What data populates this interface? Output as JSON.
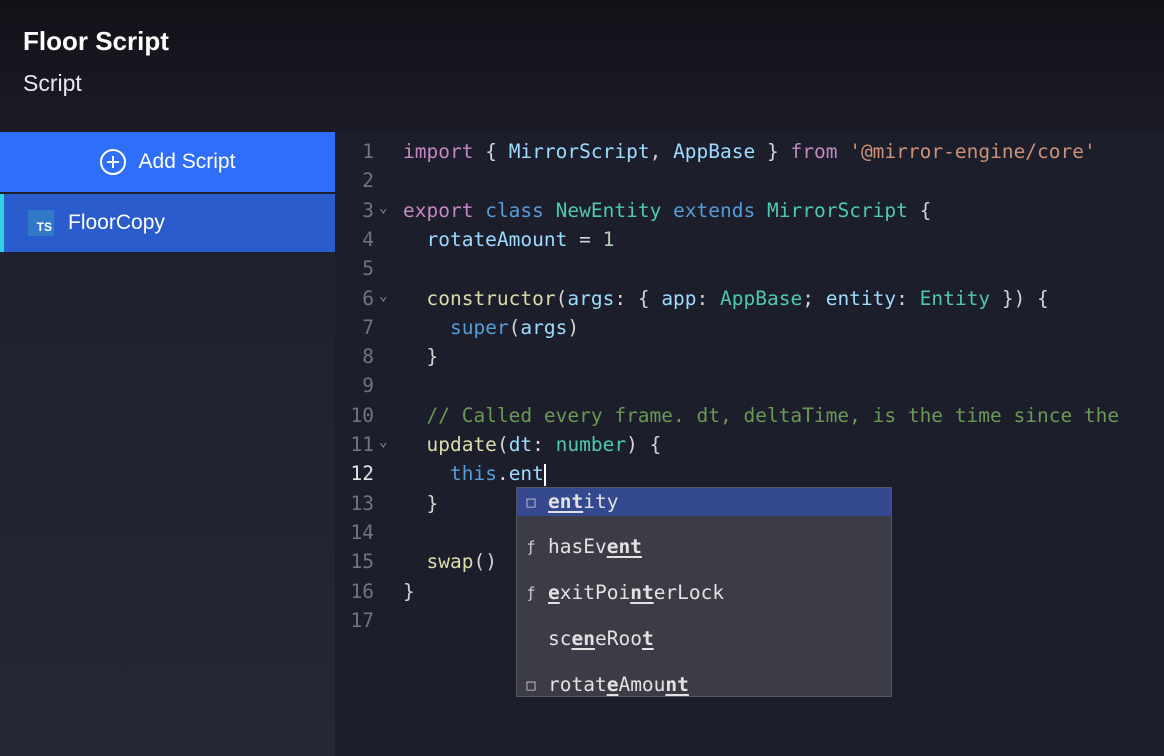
{
  "header": {
    "title": "Floor Script",
    "subtitle": "Script"
  },
  "sidebar": {
    "add_label": "Add Script",
    "items": [
      {
        "badge": "TS",
        "label": "FloorCopy"
      }
    ]
  },
  "editor": {
    "lines": [
      {
        "n": "1",
        "tokens": [
          [
            "kw",
            "import"
          ],
          [
            "p",
            " { "
          ],
          [
            "vr",
            "MirrorScript"
          ],
          [
            "p",
            ", "
          ],
          [
            "vr",
            "AppBase"
          ],
          [
            "p",
            " } "
          ],
          [
            "kw",
            "from"
          ],
          [
            "p",
            " "
          ],
          [
            "st",
            "'@mirror-engine/core'"
          ]
        ]
      },
      {
        "n": "2",
        "tokens": []
      },
      {
        "n": "3",
        "fold": true,
        "tokens": [
          [
            "kw",
            "export"
          ],
          [
            "p",
            " "
          ],
          [
            "kb",
            "class"
          ],
          [
            "p",
            " "
          ],
          [
            "ty",
            "NewEntity"
          ],
          [
            "p",
            " "
          ],
          [
            "kb",
            "extends"
          ],
          [
            "p",
            " "
          ],
          [
            "ty",
            "MirrorScript"
          ],
          [
            "p",
            " {"
          ]
        ]
      },
      {
        "n": "4",
        "tokens": [
          [
            "p",
            "  "
          ],
          [
            "vr",
            "rotateAmount"
          ],
          [
            "p",
            " = "
          ],
          [
            "nm",
            "1"
          ]
        ]
      },
      {
        "n": "5",
        "tokens": []
      },
      {
        "n": "6",
        "fold": true,
        "tokens": [
          [
            "p",
            "  "
          ],
          [
            "fn",
            "constructor"
          ],
          [
            "p",
            "("
          ],
          [
            "vr",
            "args"
          ],
          [
            "p",
            ": { "
          ],
          [
            "vr",
            "app"
          ],
          [
            "p",
            ": "
          ],
          [
            "ty",
            "AppBase"
          ],
          [
            "p",
            "; "
          ],
          [
            "vr",
            "entity"
          ],
          [
            "p",
            ": "
          ],
          [
            "ty",
            "Entity"
          ],
          [
            "p",
            " }) {"
          ]
        ]
      },
      {
        "n": "7",
        "tokens": [
          [
            "p",
            "    "
          ],
          [
            "kb",
            "super"
          ],
          [
            "p",
            "("
          ],
          [
            "vr",
            "args"
          ],
          [
            "p",
            ")"
          ]
        ]
      },
      {
        "n": "8",
        "tokens": [
          [
            "p",
            "  }"
          ]
        ]
      },
      {
        "n": "9",
        "tokens": []
      },
      {
        "n": "10",
        "tokens": [
          [
            "p",
            "  "
          ],
          [
            "cm",
            "// Called every frame. dt, deltaTime, is the time since the"
          ]
        ]
      },
      {
        "n": "11",
        "fold": true,
        "tokens": [
          [
            "p",
            "  "
          ],
          [
            "fn",
            "update"
          ],
          [
            "p",
            "("
          ],
          [
            "vr",
            "dt"
          ],
          [
            "p",
            ": "
          ],
          [
            "ty",
            "number"
          ],
          [
            "p",
            ") {"
          ]
        ]
      },
      {
        "n": "12",
        "active": true,
        "tokens": [
          [
            "p",
            "    "
          ],
          [
            "kb",
            "this"
          ],
          [
            "p",
            "."
          ],
          [
            "vr",
            "ent"
          ]
        ],
        "cursor": true
      },
      {
        "n": "13",
        "tokens": [
          [
            "p",
            "  }"
          ]
        ]
      },
      {
        "n": "14",
        "tokens": []
      },
      {
        "n": "15",
        "tokens": [
          [
            "p",
            "  "
          ],
          [
            "fn",
            "swap"
          ],
          [
            "p",
            "()"
          ]
        ]
      },
      {
        "n": "16",
        "tokens": [
          [
            "p",
            "}"
          ]
        ]
      },
      {
        "n": "17",
        "tokens": []
      }
    ]
  },
  "suggestions": [
    {
      "icon": "□",
      "icon_name": "field-icon",
      "parts": [
        [
          "u",
          "ent"
        ],
        [
          "t",
          "ity"
        ]
      ],
      "selected": true
    },
    {
      "icon": "ƒ",
      "icon_name": "method-icon",
      "parts": [
        [
          "t",
          "hasEv"
        ],
        [
          "u",
          "ent"
        ]
      ]
    },
    {
      "icon": "ƒ",
      "icon_name": "method-icon",
      "parts": [
        [
          "u",
          "e"
        ],
        [
          "t",
          "xitPoi"
        ],
        [
          "u",
          "nt"
        ],
        [
          "t",
          "erLock"
        ]
      ]
    },
    {
      "icon": "",
      "icon_name": "property-icon",
      "parts": [
        [
          "t",
          "sc"
        ],
        [
          "u",
          "en"
        ],
        [
          "t",
          "eRoo"
        ],
        [
          "u",
          "t"
        ]
      ]
    },
    {
      "icon": "□",
      "icon_name": "field-icon",
      "parts": [
        [
          "t",
          "rotat"
        ],
        [
          "u",
          "e"
        ],
        [
          "t",
          "Amou"
        ],
        [
          "u",
          "nt"
        ]
      ]
    }
  ]
}
